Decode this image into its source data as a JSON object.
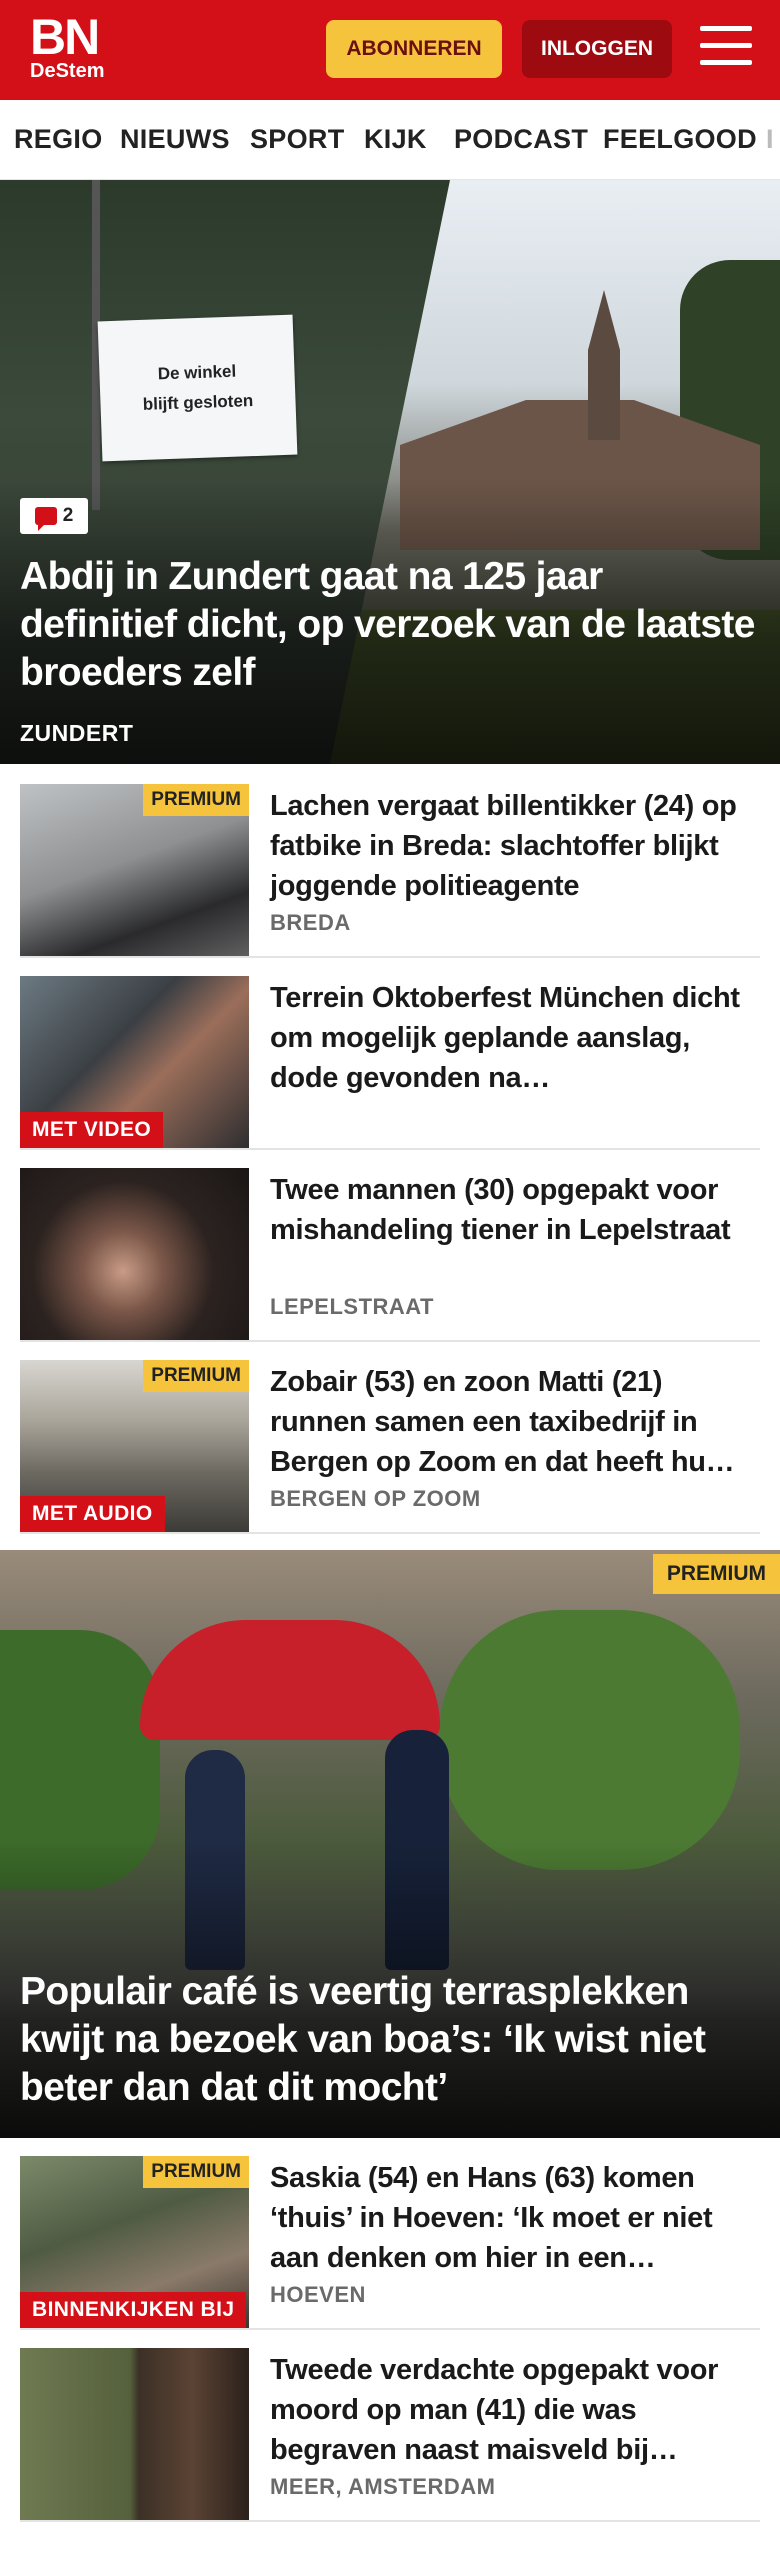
{
  "header": {
    "logo_main": "BN",
    "logo_sub": "DeStem",
    "subscribe_label": "ABONNEREN",
    "login_label": "INLOGGEN",
    "colors": {
      "brand_red": "#d30f17",
      "subscribe_yellow": "#f6c33d",
      "login_dark_red": "#9d0a10"
    }
  },
  "nav": {
    "items": [
      "REGIO",
      "NIEUWS",
      "SPORT",
      "KIJK",
      "PODCAST",
      "FEELGOOD",
      "I"
    ]
  },
  "hero": {
    "sign_text_line1": "De winkel",
    "sign_text_line2": "blijft gesloten",
    "comment_count": "2",
    "title": "Abdij in Zundert gaat na 125 jaar definitief dicht, op verzoek van de laatste broeders zelf",
    "location": "ZUNDERT"
  },
  "articles": [
    {
      "title": "Lachen vergaat billentikker (24) op fatbike in Breda: slachtoffer blijkt joggende politieagente",
      "location": "BREDA",
      "premium": "PREMIUM",
      "media": ""
    },
    {
      "title": "Terrein Oktoberfest München dicht om mogelijk geplande aanslag, dode gevonden na…",
      "location": "",
      "premium": "",
      "media": "MET VIDEO"
    },
    {
      "title": "Twee mannen (30) opgepakt voor mishandeling tiener in Lepel­straat",
      "location": "LEPELSTRAAT",
      "premium": "",
      "media": ""
    },
    {
      "title": "Zobair (53) en zoon Matti (21) runnen samen een taxibedrijf in Bergen op Zoom en dat heeft hu…",
      "location": "BERGEN OP ZOOM",
      "premium": "PREMIUM",
      "media": "MET AUDIO"
    }
  ],
  "big": {
    "premium": "PREMIUM",
    "title": "Populair café is veertig terrasplekken kwijt na bezoek van boa’s: ‘Ik wist niet beter dan dat dit mocht’"
  },
  "articles2": [
    {
      "title": "Saskia (54) en Hans (63) komen ‘thuis’ in Hoeven: ‘Ik moet er niet aan denken om hier in een…",
      "location": "HOEVEN",
      "premium": "PREMIUM",
      "media": "BINNENKIJKEN BIJ"
    },
    {
      "title": "Tweede verdachte opgepakt voor moord op man (41) die was begraven naast maisveld bij…",
      "location": "MEER, AMSTERDAM",
      "premium": "",
      "media": ""
    }
  ]
}
